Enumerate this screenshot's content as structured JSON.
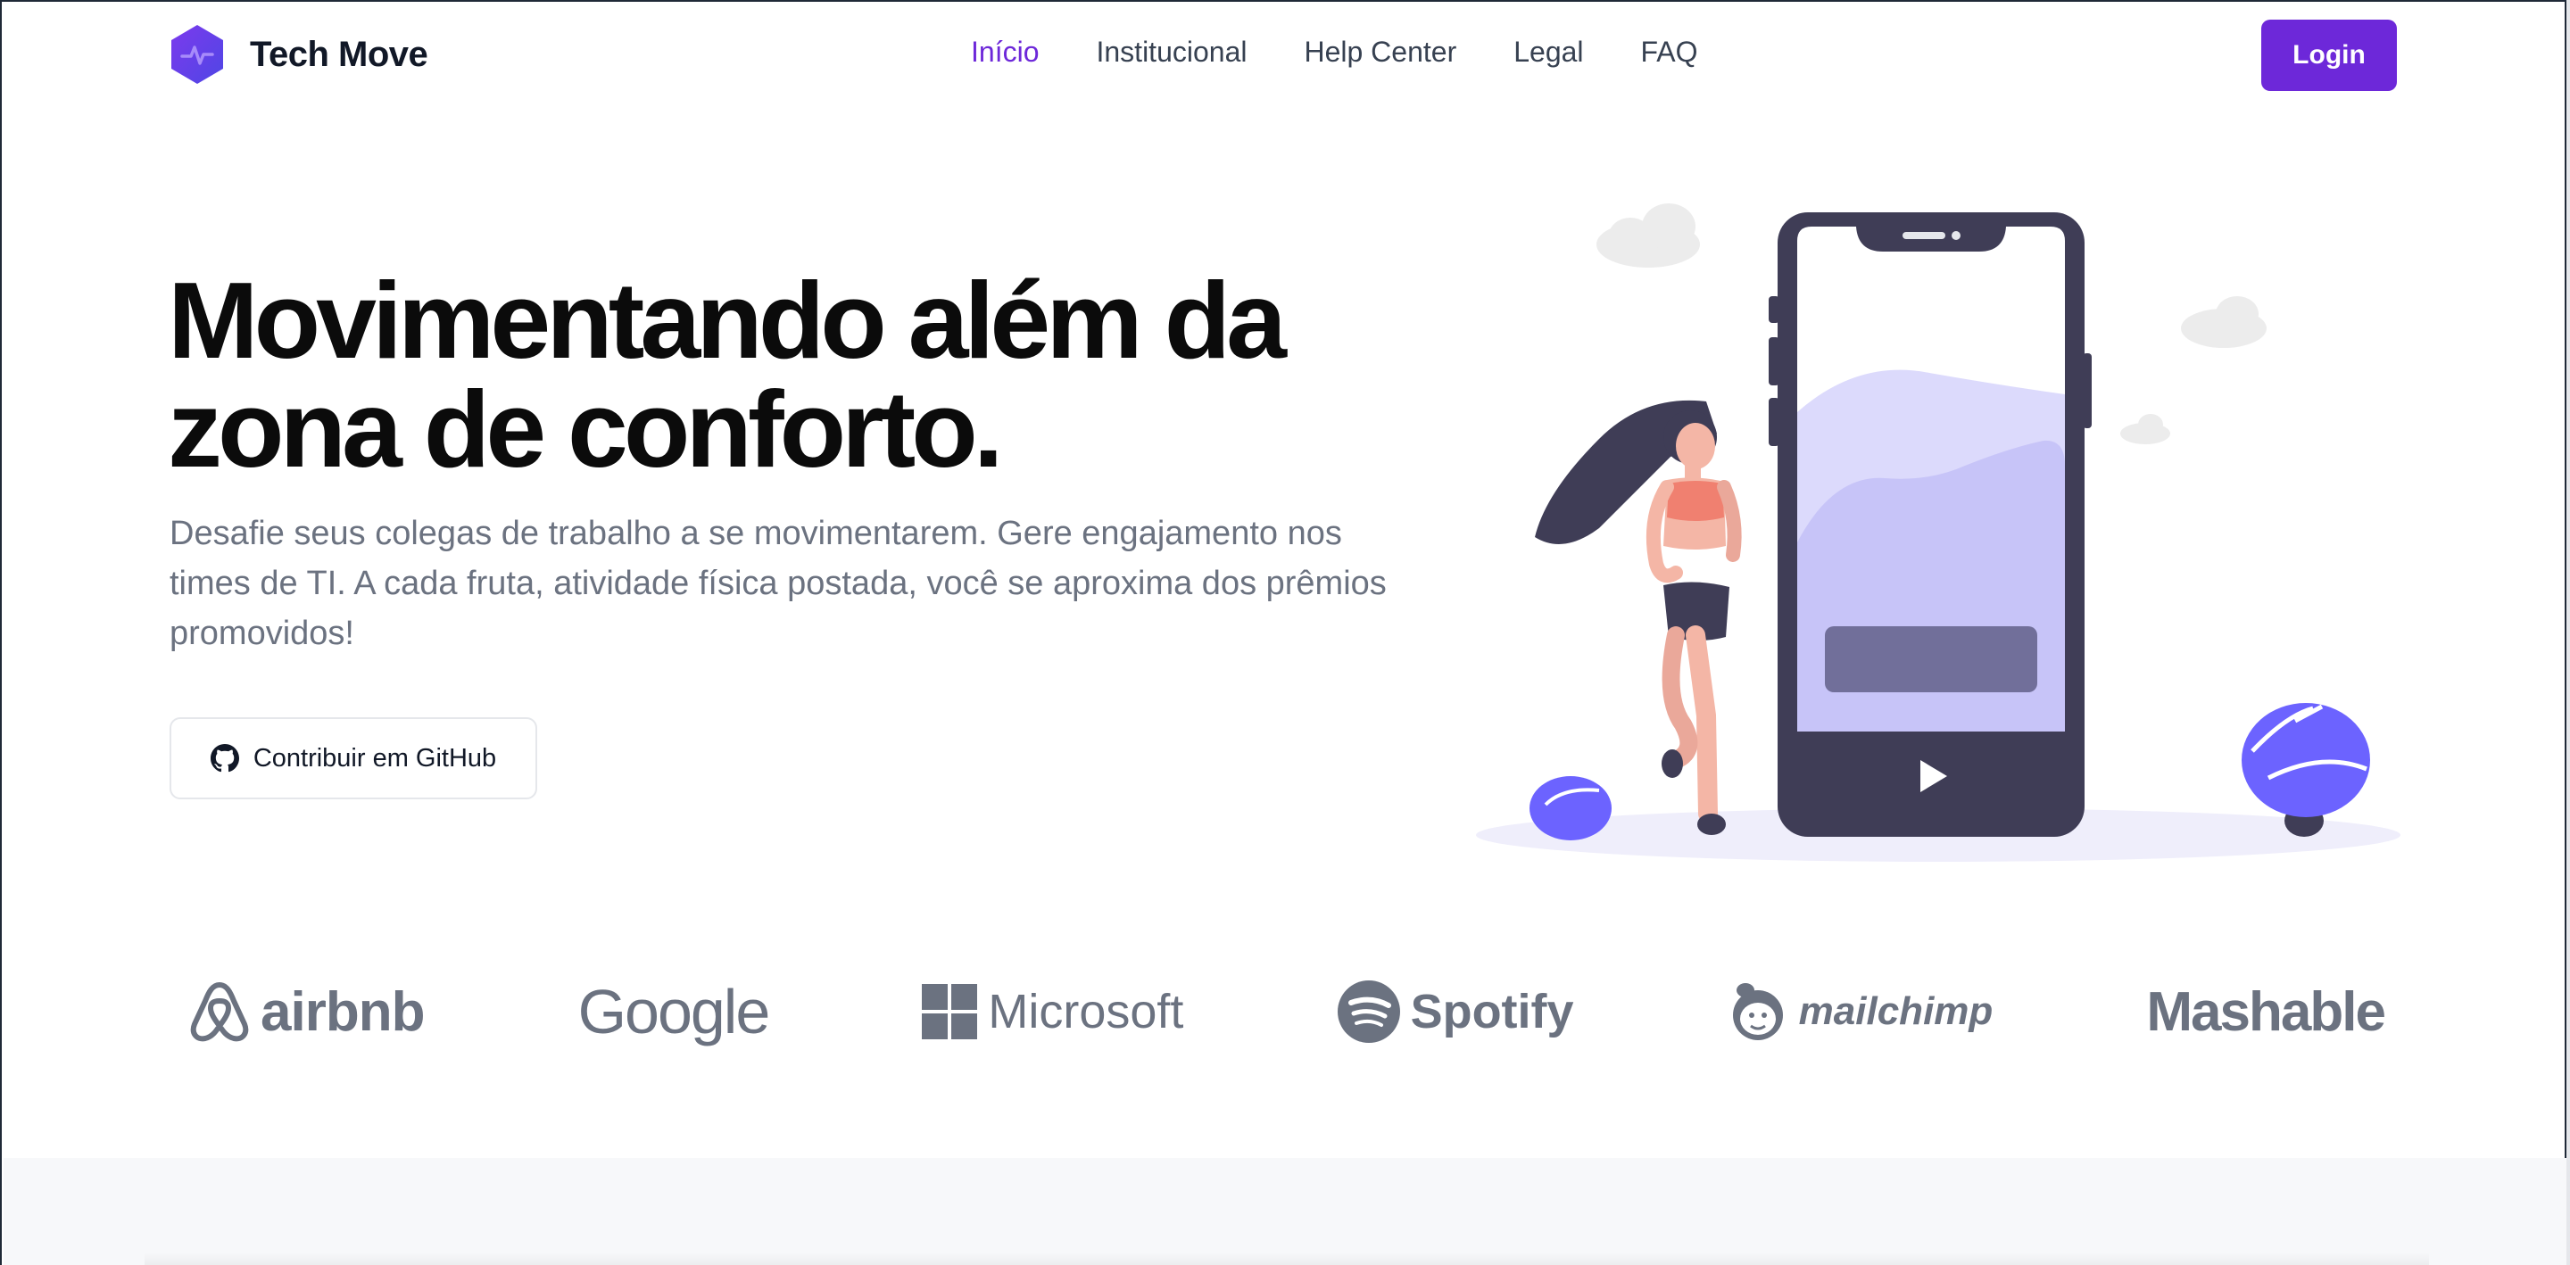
{
  "brand": {
    "name": "Tech Move",
    "icon": "hexagon-pulse-logo",
    "color": "#6d28d9"
  },
  "nav": {
    "items": [
      {
        "label": "Início",
        "active": true
      },
      {
        "label": "Institucional",
        "active": false
      },
      {
        "label": "Help Center",
        "active": false
      },
      {
        "label": "Legal",
        "active": false
      },
      {
        "label": "FAQ",
        "active": false
      }
    ],
    "login_label": "Login",
    "active_color": "#6d28d9"
  },
  "hero": {
    "title_line1": "Movimentando além da",
    "title_line2": "zona de conforto.",
    "description": "Desafie seus colegas de trabalho a se movimentarem. Gere engajamento nos times de TI. A cada fruta, atividade física postada, você se aproxima dos prêmios promovidos!",
    "github_button_label": "Contribuir em GitHub",
    "github_icon": "github-icon"
  },
  "illustration": {
    "subject": "woman-running-beside-smartphone",
    "phone_color": "#3f3d56",
    "accent_color": "#6c63ff",
    "screen_wave_color": "#c7c4f8"
  },
  "partners": [
    {
      "name": "airbnb",
      "icon": "airbnb-icon"
    },
    {
      "name": "Google",
      "icon": ""
    },
    {
      "name": "Microsoft",
      "icon": "microsoft-icon"
    },
    {
      "name": "Spotify",
      "icon": "spotify-icon"
    },
    {
      "name": "mailchimp",
      "icon": "mailchimp-icon"
    },
    {
      "name": "Mashable",
      "icon": ""
    }
  ]
}
